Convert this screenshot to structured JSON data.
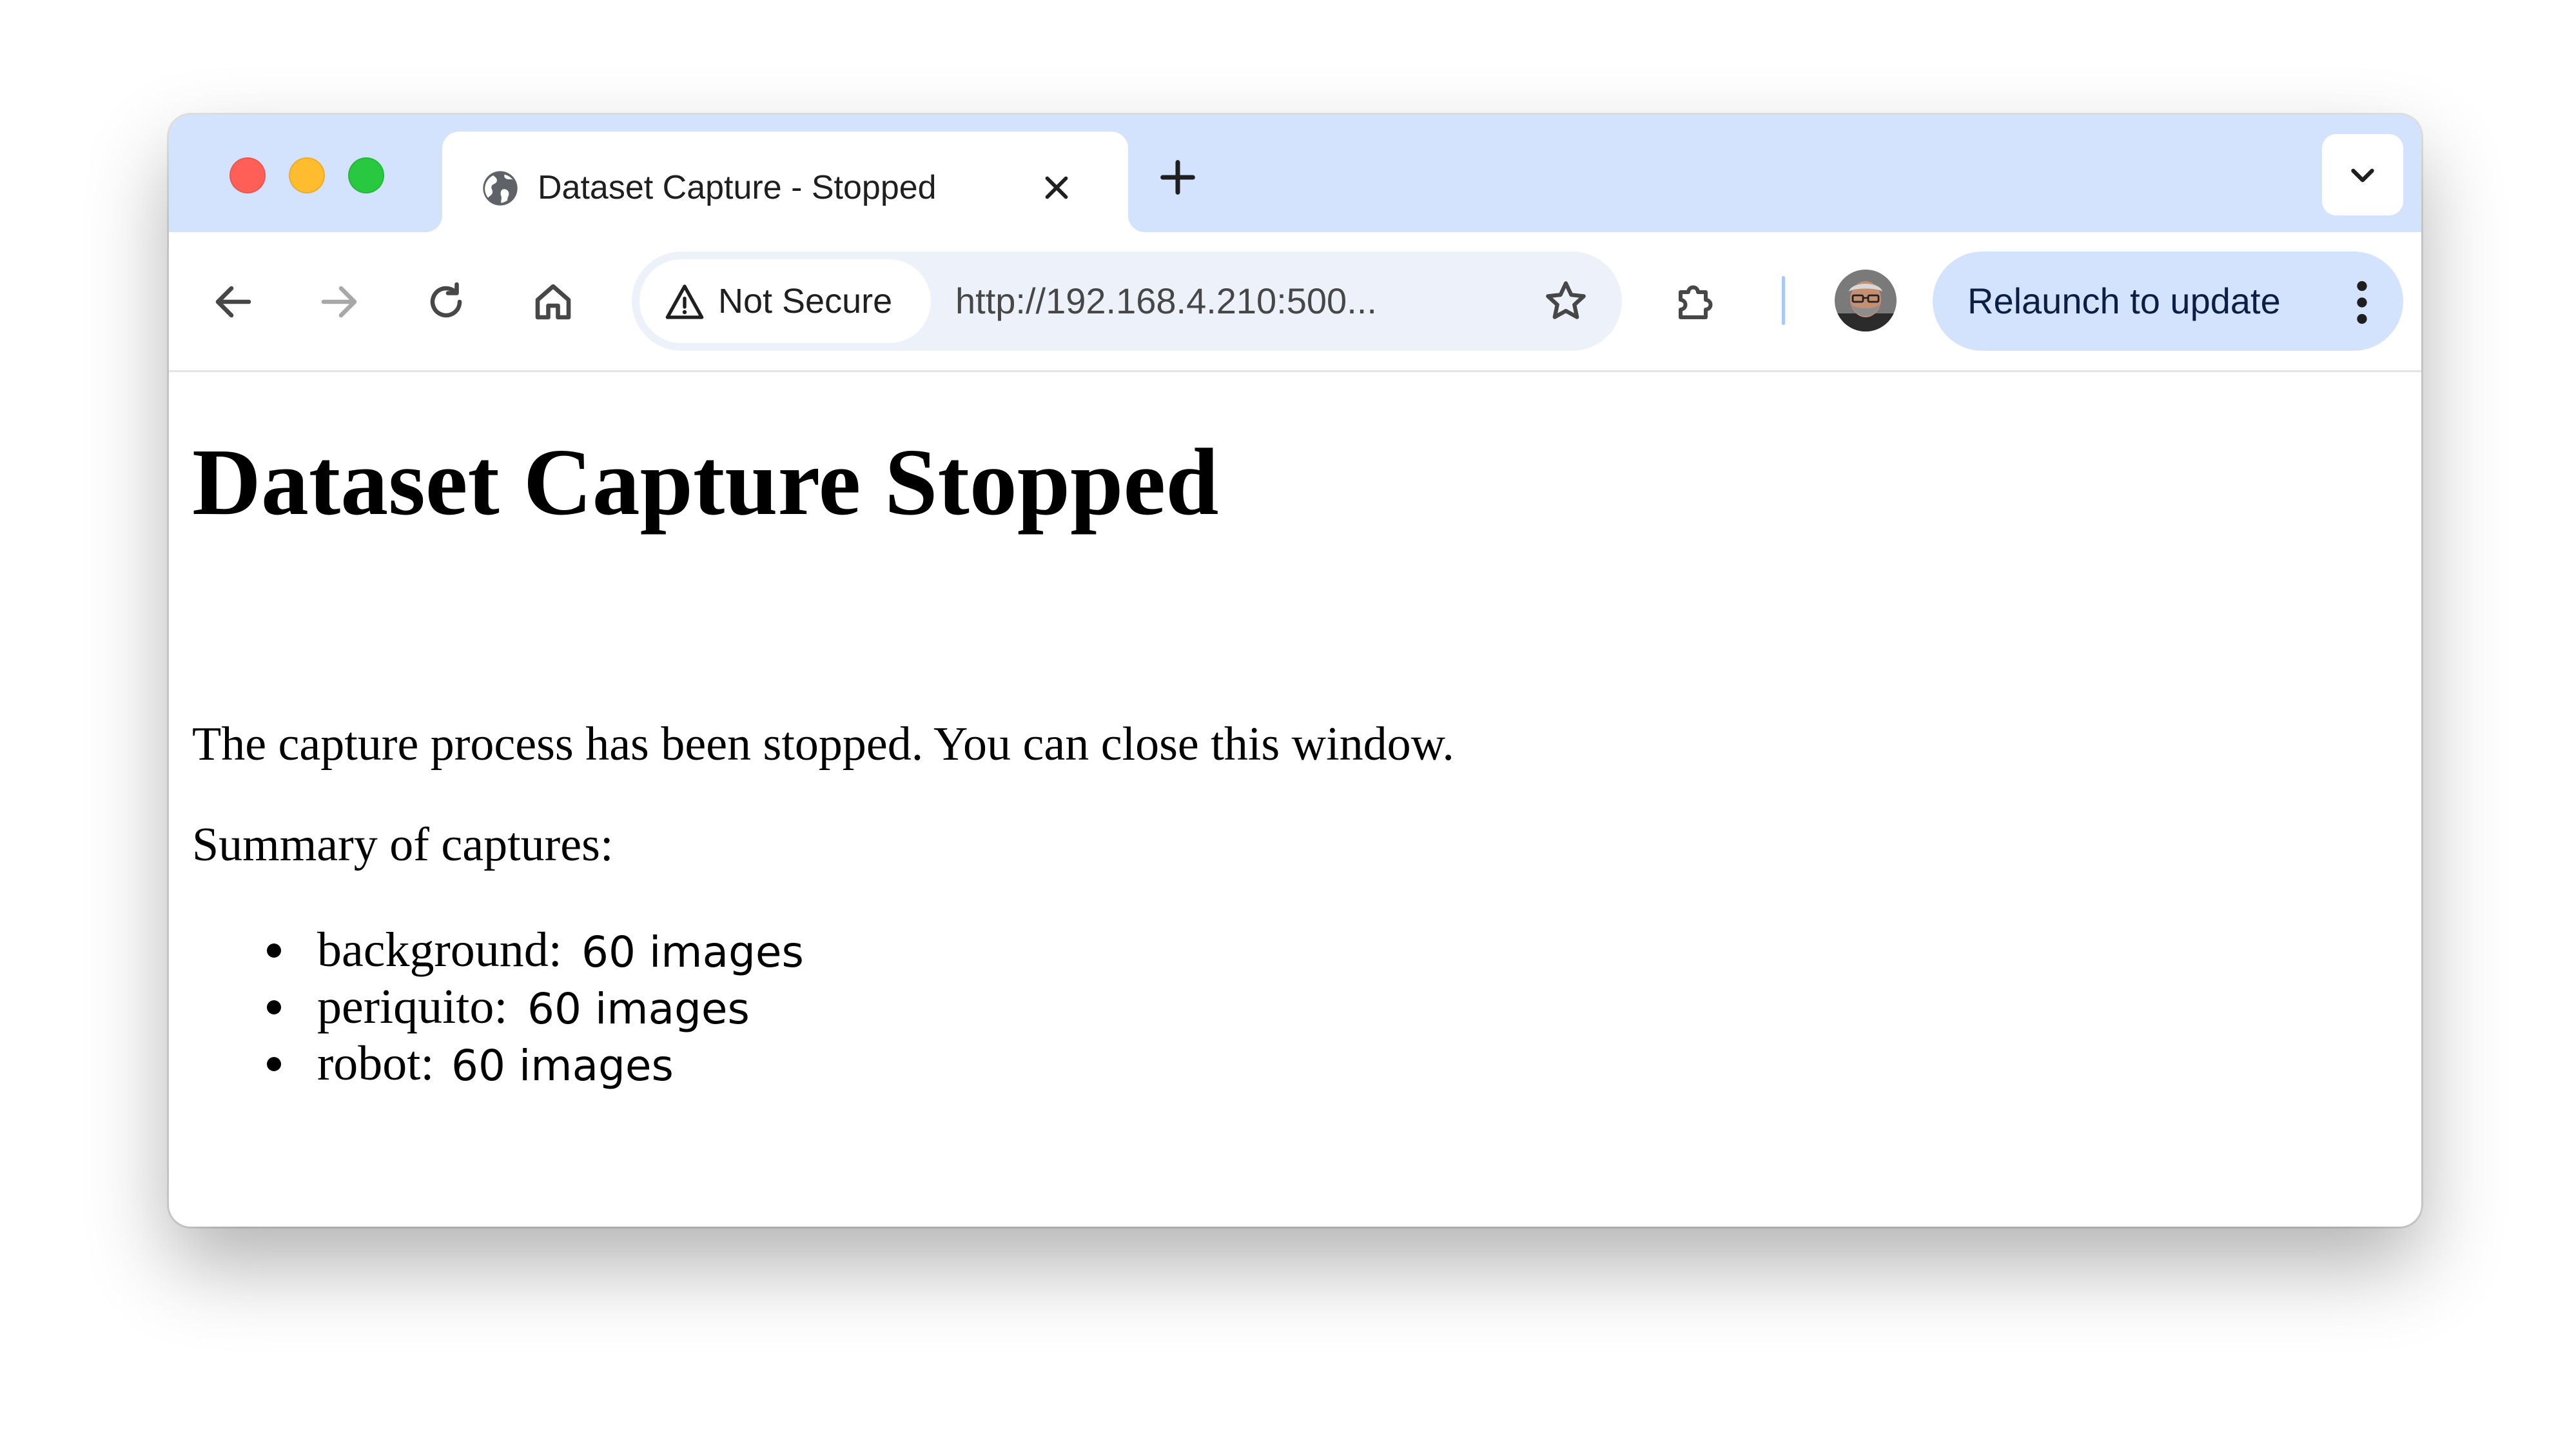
{
  "browser": {
    "tab": {
      "title": "Dataset Capture - Stopped"
    },
    "toolbar": {
      "security_chip": "Not Secure",
      "url": "http://192.168.4.210:500...",
      "relaunch_label": "Relaunch to update"
    },
    "icons": {
      "tab_favicon": "globe-icon",
      "tab_close": "close-icon",
      "new_tab": "plus-icon",
      "tab_search": "chevron-down-icon",
      "back": "arrow-left-icon",
      "forward": "arrow-right-icon",
      "reload": "reload-icon",
      "home": "home-icon",
      "security": "warning-triangle-icon",
      "bookmark": "star-icon",
      "extensions": "puzzle-icon",
      "menu": "kebab-menu-icon"
    },
    "colors": {
      "tabstrip": "#d3e3fd",
      "omnibox": "#edf2fa",
      "relaunch_button": "#d3e3fd",
      "close_dot": "#ff5f57",
      "minimize_dot": "#febc2e",
      "zoom_dot": "#28c840"
    }
  },
  "page": {
    "title": "Dataset Capture Stopped",
    "message": "The capture process has been stopped. You can close this window.",
    "summary_heading": "Summary of captures:",
    "captures": [
      {
        "label": "background:",
        "count": "60 images"
      },
      {
        "label": "periquito:",
        "count": "60 images"
      },
      {
        "label": "robot:",
        "count": "60 images"
      }
    ]
  }
}
